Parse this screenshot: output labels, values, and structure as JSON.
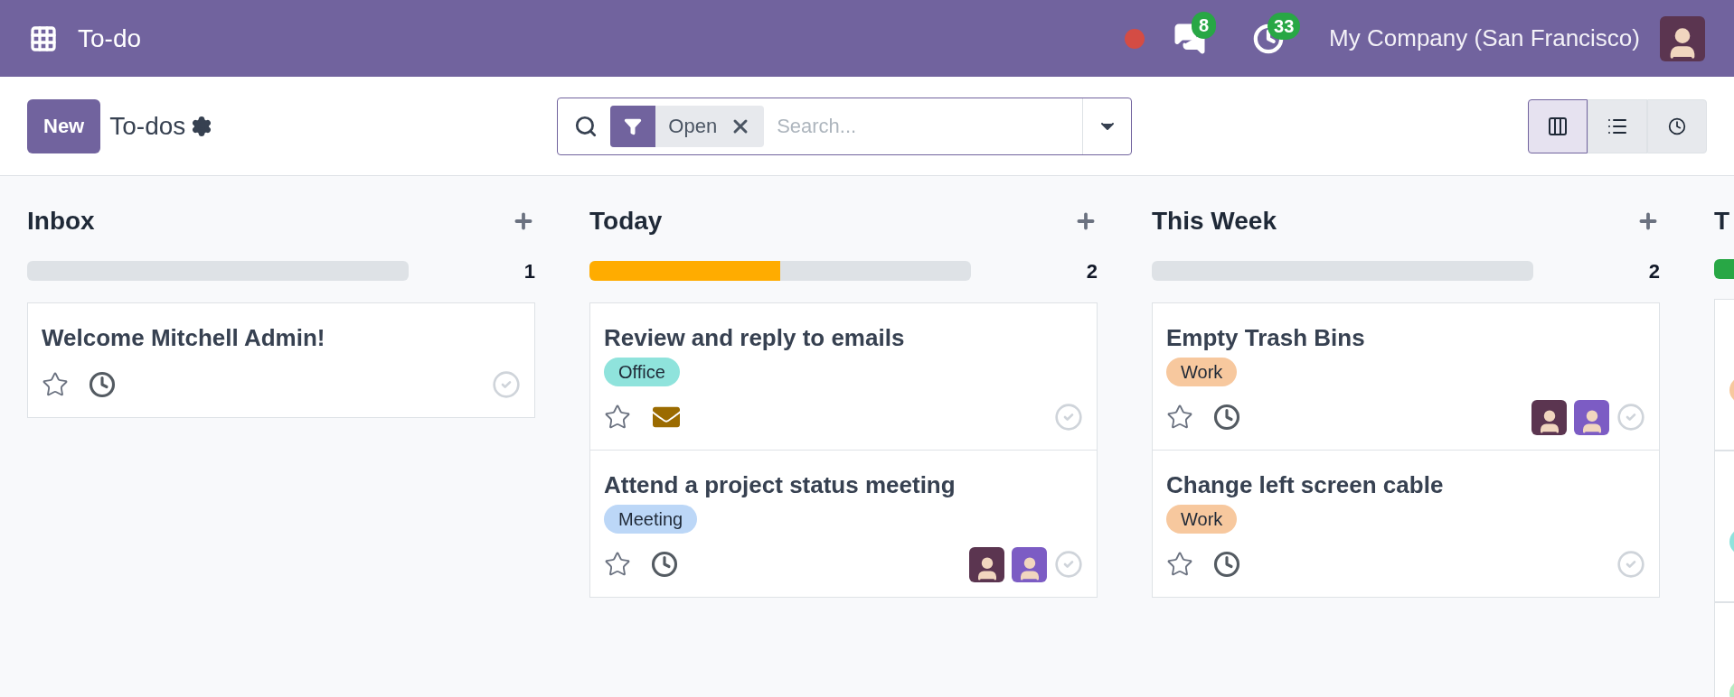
{
  "navbar": {
    "app_title": "To-do",
    "status": {
      "color": "#d44c44"
    },
    "messages_badge": "8",
    "activities_badge": "33",
    "company": "My Company (San Francisco)"
  },
  "control_panel": {
    "new_button": "New",
    "breadcrumb": "To-dos",
    "search": {
      "facets": [
        {
          "label": "Open"
        }
      ],
      "placeholder": "Search..."
    },
    "views": [
      {
        "kind": "kanban",
        "selected": true
      },
      {
        "kind": "list",
        "selected": false
      },
      {
        "kind": "activity",
        "selected": false
      }
    ]
  },
  "columns": [
    {
      "title": "Inbox",
      "count": "1",
      "progress": {
        "level": 0
      },
      "cards": [
        {
          "title": "Welcome Mitchell Admin!",
          "starred": false,
          "activity": {
            "kind": "clock"
          }
        }
      ]
    },
    {
      "title": "Today",
      "count": "2",
      "progress": {
        "level": 0.5,
        "color": "#ffac00"
      },
      "cards": [
        {
          "title": "Review and reply to emails",
          "tag": {
            "label": "Office",
            "color": "#8fe3dc"
          },
          "starred": false,
          "activity": {
            "kind": "email"
          }
        },
        {
          "title": "Attend a project status meeting",
          "tag": {
            "label": "Meeting",
            "color": "#bcd7f7"
          },
          "starred": false,
          "activity": {
            "kind": "clock"
          },
          "avatars": [
            {
              "color": "#5b3550"
            },
            {
              "color": "#7c5cc4"
            }
          ]
        }
      ]
    },
    {
      "title": "This Week",
      "count": "2",
      "progress": {
        "level": 0
      },
      "cards": [
        {
          "title": "Empty Trash Bins",
          "tag": {
            "label": "Work",
            "color": "#f7c89e"
          },
          "starred": false,
          "activity": {
            "kind": "clock"
          },
          "avatars": [
            {
              "color": "#5b3550"
            },
            {
              "color": "#7c5cc4"
            }
          ]
        },
        {
          "title": "Change left screen cable",
          "tag": {
            "label": "Work",
            "color": "#f7c89e"
          },
          "starred": false,
          "activity": {
            "kind": "clock"
          }
        }
      ]
    },
    {
      "title": "T",
      "progress": {
        "level": 1,
        "color": "#28a745"
      },
      "cards": [
        {
          "tag": {
            "color": "#f7c89e"
          }
        },
        {
          "tag": {
            "color": "#8fe3dc"
          }
        },
        {
          "tag": {
            "color": "#b7ebc0"
          }
        }
      ]
    }
  ]
}
